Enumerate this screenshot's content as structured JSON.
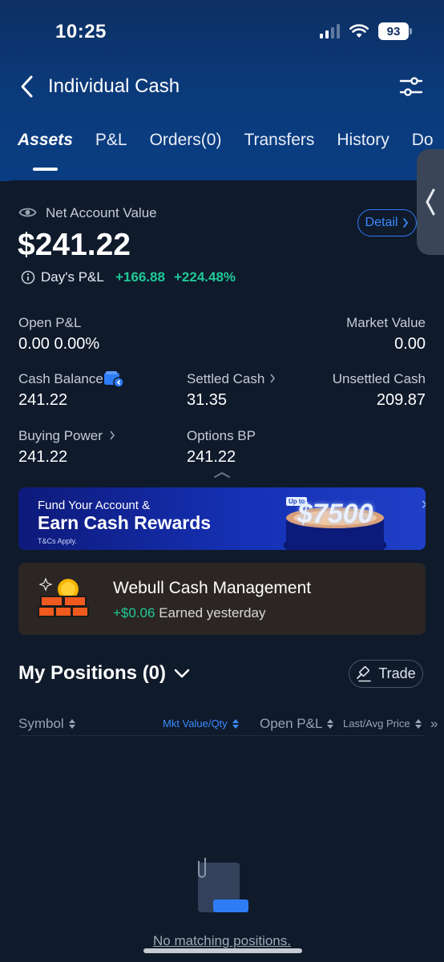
{
  "status": {
    "time": "10:25",
    "battery": "93"
  },
  "header": {
    "title": "Individual Cash"
  },
  "tabs": [
    {
      "label": "Assets"
    },
    {
      "label": "P&L"
    },
    {
      "label": "Orders(0)"
    },
    {
      "label": "Transfers"
    },
    {
      "label": "History"
    },
    {
      "label": "Do"
    }
  ],
  "account": {
    "net_label": "Net Account Value",
    "detail_label": "Detail",
    "net_value": "$241.22",
    "days_pl_label": "Day's P&L",
    "days_pl_amount": "+166.88",
    "days_pl_pct": "+224.48%"
  },
  "metrics": {
    "open_pl_label": "Open P&L",
    "open_pl_value": "0.00 0.00%",
    "market_value_label": "Market Value",
    "market_value_value": "0.00",
    "cash_balance_label": "Cash Balance",
    "cash_balance_value": "241.22",
    "settled_cash_label": "Settled Cash",
    "settled_cash_value": "31.35",
    "unsettled_cash_label": "Unsettled Cash",
    "unsettled_cash_value": "209.87",
    "buying_power_label": "Buying Power",
    "buying_power_value": "241.22",
    "options_bp_label": "Options BP",
    "options_bp_value": "241.22"
  },
  "banner": {
    "line1": "Fund Your Account &",
    "line2": "Earn Cash Rewards",
    "line3": "T&Cs Apply.",
    "upto": "Up to",
    "amount": "$7500"
  },
  "cash_management": {
    "title": "Webull Cash Management",
    "earned_amount": "+$0.06",
    "earned_label": "Earned yesterday"
  },
  "positions": {
    "title": "My Positions (0)",
    "trade_label": "Trade",
    "columns": [
      "Symbol",
      "Mkt Value/Qty",
      "Open P&L",
      "Last/Avg Price"
    ],
    "empty_text": "No matching positions."
  },
  "colors": {
    "accent": "#2f7df6",
    "gain": "#20c997",
    "background": "#0f1a2b",
    "header": "#0b3b7c"
  }
}
